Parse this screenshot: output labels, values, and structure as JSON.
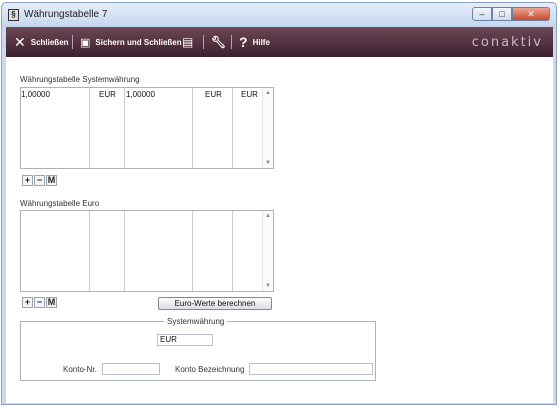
{
  "window": {
    "title": "Währungstabelle 7",
    "app_icon": "§",
    "minimize": "–",
    "maximize": "□",
    "close": "✕"
  },
  "toolbar": {
    "close_label": "Schließen",
    "save_close_label": "Sichern und Schließen",
    "help_label": "Hilfe",
    "logo": "conaktiv"
  },
  "icons": {
    "close": "close-x-icon",
    "save_close": "save-close-icon",
    "save": "floppy-icon",
    "settings": "wrench-icon",
    "help": "question-icon"
  },
  "system_table": {
    "label": "Währungstabelle Systemwährung",
    "row": [
      "1,00000",
      "EUR",
      "1,00000",
      "EUR",
      "EUR"
    ]
  },
  "euro_table": {
    "label": "Währungstabelle Euro"
  },
  "mini_buttons": {
    "add": "+",
    "remove": "−",
    "m": "M"
  },
  "euro_button": "Euro-Werte berechnen",
  "system_currency": {
    "group_label": "Systemwährung",
    "value": "EUR",
    "konto_nr_label": "Konto-Nr.",
    "konto_nr_value": "",
    "konto_bez_label": "Konto Bezeichnung",
    "konto_bez_value": ""
  }
}
